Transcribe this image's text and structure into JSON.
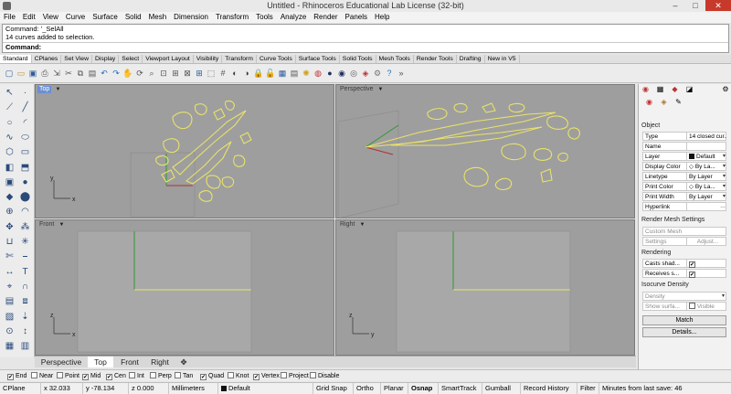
{
  "window": {
    "title": "Untitled - Rhinoceros Educational Lab License (32-bit)",
    "controls": [
      "–",
      "□",
      "✕"
    ]
  },
  "menu": [
    "File",
    "Edit",
    "View",
    "Curve",
    "Surface",
    "Solid",
    "Mesh",
    "Dimension",
    "Transform",
    "Tools",
    "Analyze",
    "Render",
    "Panels",
    "Help"
  ],
  "command": {
    "history": [
      "Command: '_SelAll",
      "14 curves added to selection."
    ],
    "prompt": "Command:"
  },
  "toolbar_tabs": [
    "Standard",
    "CPlanes",
    "Set View",
    "Display",
    "Select",
    "Viewport Layout",
    "Visibility",
    "Transform",
    "Curve Tools",
    "Surface Tools",
    "Solid Tools",
    "Mesh Tools",
    "Render Tools",
    "Drafting",
    "New in V5"
  ],
  "toolbar_icons": [
    "new-file-icon",
    "open-file-icon",
    "save-file-icon",
    "print-icon",
    "import-icon",
    "cut-icon",
    "copy-icon",
    "paste-icon",
    "undo-icon",
    "redo-icon",
    "pan-icon",
    "rotate-view-icon",
    "zoom-icon",
    "zoom-window-icon",
    "zoom-extents-icon",
    "zoom-selected-icon",
    "four-viewports-icon",
    "select-window-icon",
    "grid-snap-icon",
    "hide-icon",
    "show-icon",
    "lock-icon",
    "unlock-icon",
    "layer-icon",
    "properties-icon",
    "light-icon",
    "color-wheel-icon",
    "shaded-icon",
    "rendered-icon",
    "material-icon",
    "render-icon",
    "options-icon",
    "help-icon",
    "more-icon"
  ],
  "left_tools": [
    "select-arrow-icon",
    "point-icon",
    "polyline-icon",
    "line-icon",
    "circle-icon",
    "arc-icon",
    "curve-icon",
    "ellipse-icon",
    "polygon-icon",
    "rectangle-icon",
    "surface-icon",
    "extrude-icon",
    "box-icon",
    "sphere-icon",
    "mesh-icon",
    "cylinder-icon",
    "boolean-icon",
    "fillet-icon",
    "move-icon",
    "array-icon",
    "join-icon",
    "explode-icon",
    "trim-icon",
    "split-icon",
    "dimension-icon",
    "text-icon",
    "analyze-icon",
    "curvature-icon",
    "block-icon",
    "group-icon",
    "hatch-icon",
    "project-icon",
    "point-on-icon",
    "distance-icon",
    "cplane-icon",
    "layout-icon"
  ],
  "viewports": {
    "top": {
      "label": "Top",
      "axis_x": "x",
      "axis_y": "y"
    },
    "perspective": {
      "label": "Perspective"
    },
    "front": {
      "label": "Front",
      "axis_x": "x",
      "axis_y": "z"
    },
    "right": {
      "label": "Right",
      "axis_x": "y",
      "axis_y": "z"
    }
  },
  "viewport_tabs": [
    "Perspective",
    "Top",
    "Front",
    "Right"
  ],
  "viewport_tab_active": "Top",
  "osnap": [
    {
      "label": "End",
      "checked": true
    },
    {
      "label": "Near",
      "checked": false
    },
    {
      "label": "Point",
      "checked": false
    },
    {
      "label": "Mid",
      "checked": true
    },
    {
      "label": "Cen",
      "checked": true
    },
    {
      "label": "Int",
      "checked": false
    },
    {
      "label": "Perp",
      "checked": false
    },
    {
      "label": "Tan",
      "checked": false
    },
    {
      "label": "Quad",
      "checked": true
    },
    {
      "label": "Knot",
      "checked": false
    },
    {
      "label": "Vertex",
      "checked": true
    },
    {
      "label": "Project",
      "checked": false
    },
    {
      "label": "Disable",
      "checked": false
    }
  ],
  "status": {
    "cplane": "CPlane",
    "x": "x 32.033",
    "y": "y -78.134",
    "z": "z 0.000",
    "units": "Millimeters",
    "layer": "Default",
    "grid_snap": "Grid Snap",
    "ortho": "Ortho",
    "planar": "Planar",
    "osnap": "Osnap",
    "smarttrack": "SmartTrack",
    "gumball": "Gumball",
    "record_history": "Record History",
    "filter": "Filter",
    "last_save": "Minutes from last save: 46"
  },
  "properties": {
    "section_object": "Object",
    "rows": [
      {
        "key": "Type",
        "value": "14 closed cur..."
      },
      {
        "key": "Name",
        "value": ""
      },
      {
        "key": "Layer",
        "value": "Default"
      },
      {
        "key": "Display Color",
        "value": "By La..."
      },
      {
        "key": "Linetype",
        "value": "By Layer"
      },
      {
        "key": "Print Color",
        "value": "By La..."
      },
      {
        "key": "Print Width",
        "value": "By Layer"
      },
      {
        "key": "Hyperlink",
        "value": ""
      }
    ],
    "section_mesh": "Render Mesh Settings",
    "custom_mesh": "Custom Mesh",
    "settings": "Settings",
    "adjust": "Adjust...",
    "section_rendering": "Rendering",
    "casts_shadows": "Casts shad...",
    "receives_shadows": "Receives s...",
    "section_isocurve": "Isocurve Density",
    "density": "Density",
    "show_surface": "Show surfa...",
    "visible": "Visible",
    "match": "Match",
    "details": "Details..."
  },
  "colors": {
    "curve": "#e8e26a",
    "viewport_bg": "#9e9e9e",
    "grid": "#b0b0b0",
    "active_label": "#6c8fd1",
    "close": "#c7392b"
  }
}
